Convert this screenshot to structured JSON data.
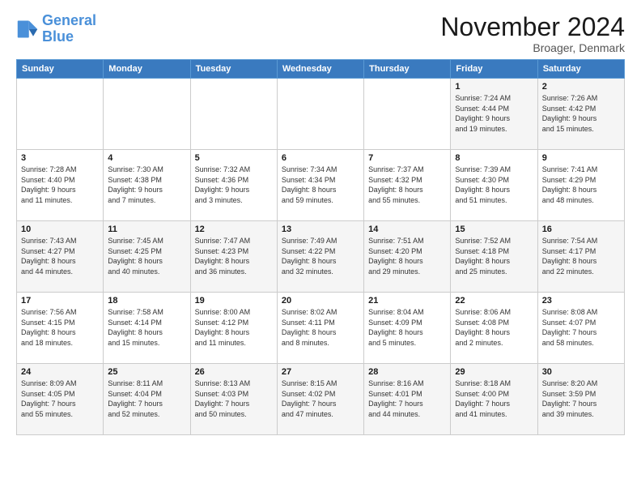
{
  "logo": {
    "line1": "General",
    "line2": "Blue"
  },
  "title": "November 2024",
  "location": "Broager, Denmark",
  "days_header": [
    "Sunday",
    "Monday",
    "Tuesday",
    "Wednesday",
    "Thursday",
    "Friday",
    "Saturday"
  ],
  "weeks": [
    [
      {
        "day": "",
        "info": ""
      },
      {
        "day": "",
        "info": ""
      },
      {
        "day": "",
        "info": ""
      },
      {
        "day": "",
        "info": ""
      },
      {
        "day": "",
        "info": ""
      },
      {
        "day": "1",
        "info": "Sunrise: 7:24 AM\nSunset: 4:44 PM\nDaylight: 9 hours\nand 19 minutes."
      },
      {
        "day": "2",
        "info": "Sunrise: 7:26 AM\nSunset: 4:42 PM\nDaylight: 9 hours\nand 15 minutes."
      }
    ],
    [
      {
        "day": "3",
        "info": "Sunrise: 7:28 AM\nSunset: 4:40 PM\nDaylight: 9 hours\nand 11 minutes."
      },
      {
        "day": "4",
        "info": "Sunrise: 7:30 AM\nSunset: 4:38 PM\nDaylight: 9 hours\nand 7 minutes."
      },
      {
        "day": "5",
        "info": "Sunrise: 7:32 AM\nSunset: 4:36 PM\nDaylight: 9 hours\nand 3 minutes."
      },
      {
        "day": "6",
        "info": "Sunrise: 7:34 AM\nSunset: 4:34 PM\nDaylight: 8 hours\nand 59 minutes."
      },
      {
        "day": "7",
        "info": "Sunrise: 7:37 AM\nSunset: 4:32 PM\nDaylight: 8 hours\nand 55 minutes."
      },
      {
        "day": "8",
        "info": "Sunrise: 7:39 AM\nSunset: 4:30 PM\nDaylight: 8 hours\nand 51 minutes."
      },
      {
        "day": "9",
        "info": "Sunrise: 7:41 AM\nSunset: 4:29 PM\nDaylight: 8 hours\nand 48 minutes."
      }
    ],
    [
      {
        "day": "10",
        "info": "Sunrise: 7:43 AM\nSunset: 4:27 PM\nDaylight: 8 hours\nand 44 minutes."
      },
      {
        "day": "11",
        "info": "Sunrise: 7:45 AM\nSunset: 4:25 PM\nDaylight: 8 hours\nand 40 minutes."
      },
      {
        "day": "12",
        "info": "Sunrise: 7:47 AM\nSunset: 4:23 PM\nDaylight: 8 hours\nand 36 minutes."
      },
      {
        "day": "13",
        "info": "Sunrise: 7:49 AM\nSunset: 4:22 PM\nDaylight: 8 hours\nand 32 minutes."
      },
      {
        "day": "14",
        "info": "Sunrise: 7:51 AM\nSunset: 4:20 PM\nDaylight: 8 hours\nand 29 minutes."
      },
      {
        "day": "15",
        "info": "Sunrise: 7:52 AM\nSunset: 4:18 PM\nDaylight: 8 hours\nand 25 minutes."
      },
      {
        "day": "16",
        "info": "Sunrise: 7:54 AM\nSunset: 4:17 PM\nDaylight: 8 hours\nand 22 minutes."
      }
    ],
    [
      {
        "day": "17",
        "info": "Sunrise: 7:56 AM\nSunset: 4:15 PM\nDaylight: 8 hours\nand 18 minutes."
      },
      {
        "day": "18",
        "info": "Sunrise: 7:58 AM\nSunset: 4:14 PM\nDaylight: 8 hours\nand 15 minutes."
      },
      {
        "day": "19",
        "info": "Sunrise: 8:00 AM\nSunset: 4:12 PM\nDaylight: 8 hours\nand 11 minutes."
      },
      {
        "day": "20",
        "info": "Sunrise: 8:02 AM\nSunset: 4:11 PM\nDaylight: 8 hours\nand 8 minutes."
      },
      {
        "day": "21",
        "info": "Sunrise: 8:04 AM\nSunset: 4:09 PM\nDaylight: 8 hours\nand 5 minutes."
      },
      {
        "day": "22",
        "info": "Sunrise: 8:06 AM\nSunset: 4:08 PM\nDaylight: 8 hours\nand 2 minutes."
      },
      {
        "day": "23",
        "info": "Sunrise: 8:08 AM\nSunset: 4:07 PM\nDaylight: 7 hours\nand 58 minutes."
      }
    ],
    [
      {
        "day": "24",
        "info": "Sunrise: 8:09 AM\nSunset: 4:05 PM\nDaylight: 7 hours\nand 55 minutes."
      },
      {
        "day": "25",
        "info": "Sunrise: 8:11 AM\nSunset: 4:04 PM\nDaylight: 7 hours\nand 52 minutes."
      },
      {
        "day": "26",
        "info": "Sunrise: 8:13 AM\nSunset: 4:03 PM\nDaylight: 7 hours\nand 50 minutes."
      },
      {
        "day": "27",
        "info": "Sunrise: 8:15 AM\nSunset: 4:02 PM\nDaylight: 7 hours\nand 47 minutes."
      },
      {
        "day": "28",
        "info": "Sunrise: 8:16 AM\nSunset: 4:01 PM\nDaylight: 7 hours\nand 44 minutes."
      },
      {
        "day": "29",
        "info": "Sunrise: 8:18 AM\nSunset: 4:00 PM\nDaylight: 7 hours\nand 41 minutes."
      },
      {
        "day": "30",
        "info": "Sunrise: 8:20 AM\nSunset: 3:59 PM\nDaylight: 7 hours\nand 39 minutes."
      }
    ]
  ]
}
